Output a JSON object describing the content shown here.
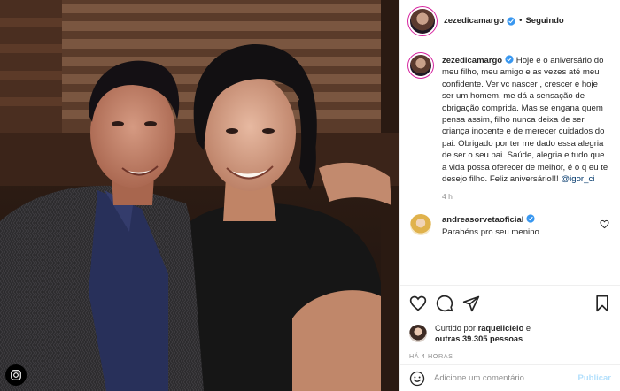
{
  "post": {
    "author": "zezedicamargo",
    "follow_status": "Seguindo",
    "more_icon": "more-horizontal-icon",
    "caption": {
      "username": "zezedicamargo",
      "text": "Hoje é o aniversário do meu filho, meu amigo e as vezes até meu confidente. Ver vc nascer , crescer e hoje ser um homem, me dá a sensação de obrigação comprida. Mas se engana quem pensa assim, filho nunca deixa de ser criança inocente e de merecer cuidados do pai. Obrigado por ter me dado essa alegria de ser o seu pai. Saúde, alegria e tudo que a vida possa oferecer de melhor, é o q eu te desejo filho. Feliz aniversário!!!",
      "mention": "@igor_ci",
      "age": "4 h"
    },
    "comments": [
      {
        "username": "andreasorvetaoficial",
        "text": "Parabéns pro seu menino"
      }
    ],
    "likes": {
      "prefix": "Curtido por",
      "first_liker": "raquellcielo",
      "joiner": "e",
      "others": "outras 39.305 pessoas"
    },
    "timestamp": "HÁ 4 HORAS",
    "add_comment": {
      "placeholder": "Adicione um comentário...",
      "publish_label": "Publicar"
    }
  },
  "icons": [
    "verified-badge-icon",
    "heart-icon",
    "comment-icon",
    "share-icon",
    "bookmark-icon",
    "emoji-icon",
    "instagram-icon"
  ],
  "colors": {
    "verified": "#3897f0",
    "link": "#00376b",
    "secondary_text": "#8e8e8e",
    "publish_disabled": "#b2dffc",
    "border": "#efefef"
  }
}
